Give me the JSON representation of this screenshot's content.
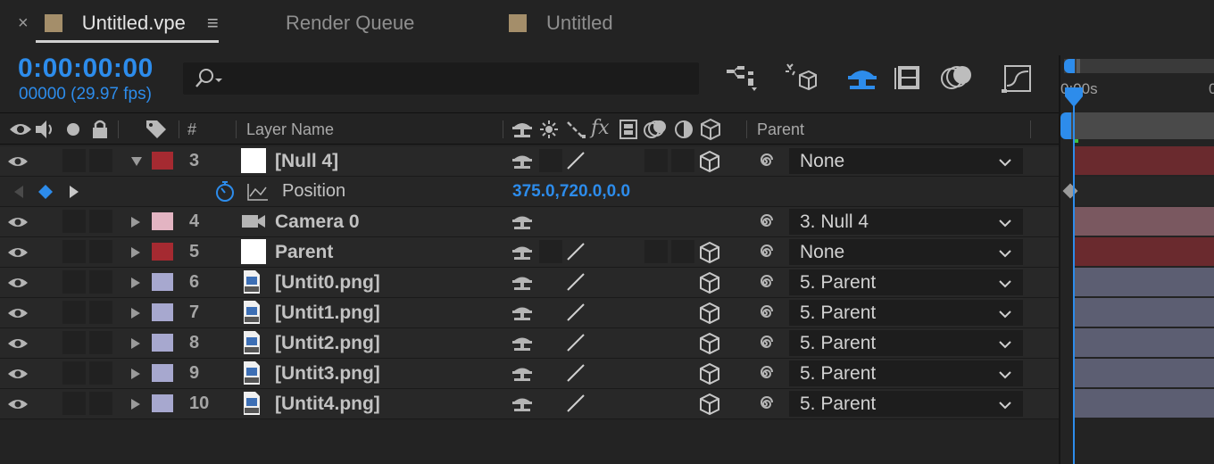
{
  "tabs": [
    {
      "label": "Untitled.vpe",
      "active": true,
      "close": "×",
      "menu": "≡"
    },
    {
      "label": "Render Queue",
      "active": false
    },
    {
      "label": "Untitled",
      "active": false
    }
  ],
  "header": {
    "timecode": "0:00:00:00",
    "frame_fps": "00000 (29.97 fps)",
    "search": {
      "value": "",
      "placeholder": ""
    }
  },
  "columns": {
    "hash": "#",
    "layer_name": "Layer Name",
    "fx": "fx",
    "parent": "Parent"
  },
  "timeline": {
    "ruler_start": "0:00s",
    "ruler_next": "0"
  },
  "layers": {
    "l3": {
      "num": "3",
      "name": "[Null 4]",
      "parent": "None",
      "label_color": "#a52a31"
    },
    "pos": {
      "name": "Position",
      "value": "375.0,720.0,0.0"
    },
    "l4": {
      "num": "4",
      "name": "Camera 0",
      "parent": "3. Null 4",
      "label_color": "#e3b4c2"
    },
    "l5": {
      "num": "5",
      "name": "Parent",
      "parent": "None",
      "label_color": "#a52a31"
    },
    "l6": {
      "num": "6",
      "name": "[Untit0.png]",
      "parent": "5. Parent",
      "label_color": "#a7a8cf"
    },
    "l7": {
      "num": "7",
      "name": "[Untit1.png]",
      "parent": "5. Parent",
      "label_color": "#a7a8cf"
    },
    "l8": {
      "num": "8",
      "name": "[Untit2.png]",
      "parent": "5. Parent",
      "label_color": "#a7a8cf"
    },
    "l9": {
      "num": "9",
      "name": "[Untit3.png]",
      "parent": "5. Parent",
      "label_color": "#a7a8cf"
    },
    "l10": {
      "num": "10",
      "name": "[Untit4.png]",
      "parent": "5. Parent",
      "label_color": "#a7a8cf"
    }
  },
  "colors": {
    "accent": "#2d8ceb",
    "red_bar": "#6a2a2e",
    "pink_bar": "#7a5860",
    "lavender_bar": "#5c5e72"
  }
}
